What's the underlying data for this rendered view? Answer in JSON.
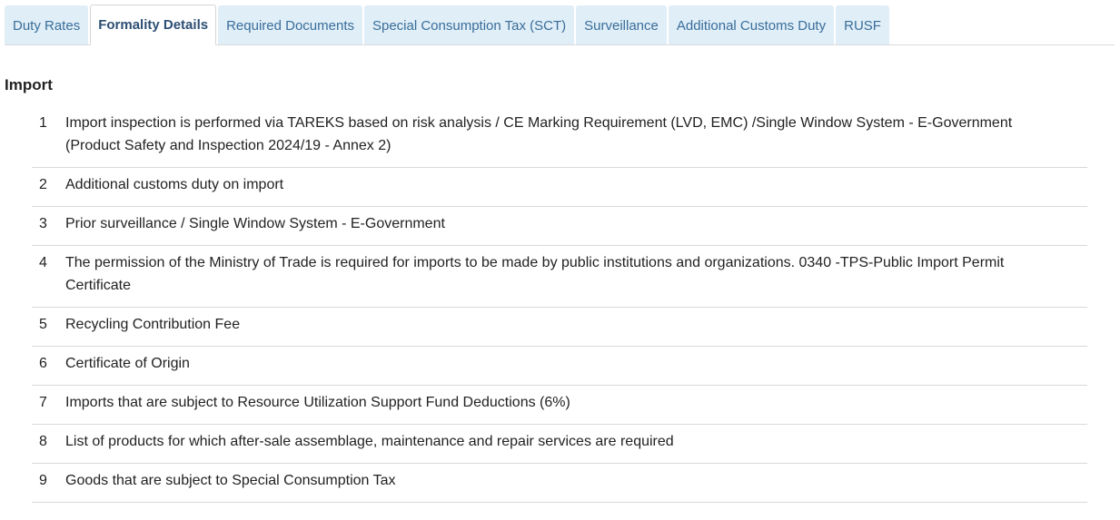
{
  "tabs": [
    {
      "label": "Duty Rates",
      "active": false
    },
    {
      "label": "Formality Details",
      "active": true
    },
    {
      "label": "Required Documents",
      "active": false
    },
    {
      "label": "Special Consumption Tax (SCT)",
      "active": false
    },
    {
      "label": "Surveillance",
      "active": false
    },
    {
      "label": "Additional Customs Duty",
      "active": false
    },
    {
      "label": "RUSF",
      "active": false
    }
  ],
  "section": {
    "title": "Import"
  },
  "items": [
    {
      "number": "1",
      "text": "Import inspection is performed via TAREKS based on risk analysis / CE Marking Requirement (LVD, EMC) /Single Window System - E-Government (Product Safety and Inspection 2024/19 - Annex 2)"
    },
    {
      "number": "2",
      "text": "Additional customs duty on import"
    },
    {
      "number": "3",
      "text": "Prior surveillance / Single Window System - E-Government"
    },
    {
      "number": "4",
      "text": "The permission of the Ministry of Trade is required for imports to be made by public institutions and organizations. 0340 -TPS-Public Import Permit Certificate"
    },
    {
      "number": "5",
      "text": "Recycling Contribution Fee"
    },
    {
      "number": "6",
      "text": "Certificate of Origin"
    },
    {
      "number": "7",
      "text": "Imports that are subject to Resource Utilization Support Fund Deductions (6%)"
    },
    {
      "number": "8",
      "text": "List of products for which after-sale assemblage, maintenance and repair services are required"
    },
    {
      "number": "9",
      "text": "Goods that are subject to Special Consumption Tax"
    }
  ],
  "colors": {
    "tab_bg": "#dfeef7",
    "tab_text": "#3a6d9a",
    "active_tab_text": "#2d4f73",
    "divider": "#d9d9d9"
  }
}
